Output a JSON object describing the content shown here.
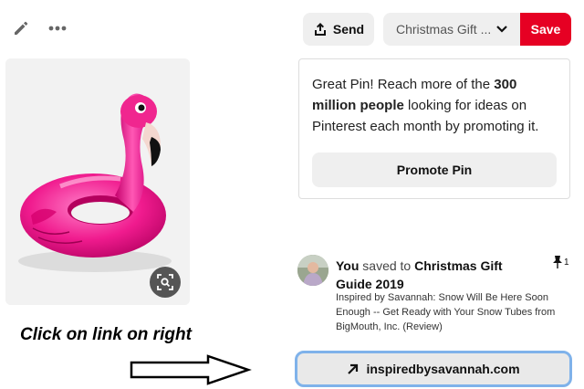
{
  "toolbar": {
    "edit_icon": "pencil-icon",
    "more_icon": "ellipsis-icon",
    "send_label": "Send",
    "send_icon": "share-icon",
    "board_label": "Christmas Gift ...",
    "board_chevron": "chevron-down-icon",
    "save_label": "Save",
    "save_color": "#e60023"
  },
  "pin": {
    "image": "pink-flamingo-float",
    "lens_icon": "visual-search-icon"
  },
  "promo": {
    "text_before": "Great Pin! Reach more of the ",
    "text_bold": "300 million people",
    "text_after": " looking for ideas on Pinterest each month by promoting it.",
    "button_label": "Promote Pin"
  },
  "activity": {
    "user": "You",
    "verb": "saved to",
    "board": "Christmas Gift Guide 2019",
    "pin_count": "1",
    "pin_icon": "pushpin-icon",
    "description": "Inspired by Savannah: Snow Will Be Here Soon Enough -- Get Ready with Your Snow Tubes from BigMouth, Inc. (Review)"
  },
  "annotation": {
    "text": "Click on link on right"
  },
  "link": {
    "label": "inspiredbysavannah.com",
    "icon": "arrow-up-right-icon",
    "highlight_color": "#7fb2ea"
  }
}
